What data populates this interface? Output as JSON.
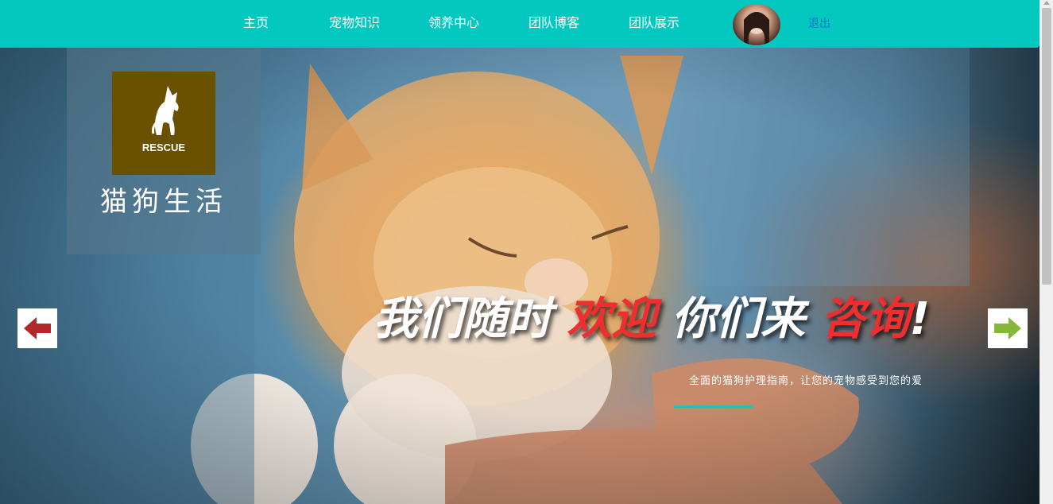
{
  "nav": {
    "items": [
      {
        "label": "主页"
      },
      {
        "label": "宠物知识"
      },
      {
        "label": "领养中心"
      },
      {
        "label": "团队博客"
      },
      {
        "label": "团队展示"
      }
    ],
    "logout_label": "退出",
    "brand_color": "#03c8c0"
  },
  "logo": {
    "badge_text": "RESCUE",
    "site_name": "猫狗生活",
    "badge_color": "#6a5100"
  },
  "hero": {
    "headline": {
      "part1": "我们随时",
      "part2": "欢迎",
      "part3": "你们来",
      "part4": "咨询",
      "part5": "!"
    },
    "subtitle": "全面的猫狗护理指南，让您的宠物感受到您的爱",
    "highlight_color": "#ef2f2f",
    "accent_color": "#2bbfb0",
    "prev_icon": "arrow-left-icon",
    "next_icon": "arrow-right-icon"
  }
}
